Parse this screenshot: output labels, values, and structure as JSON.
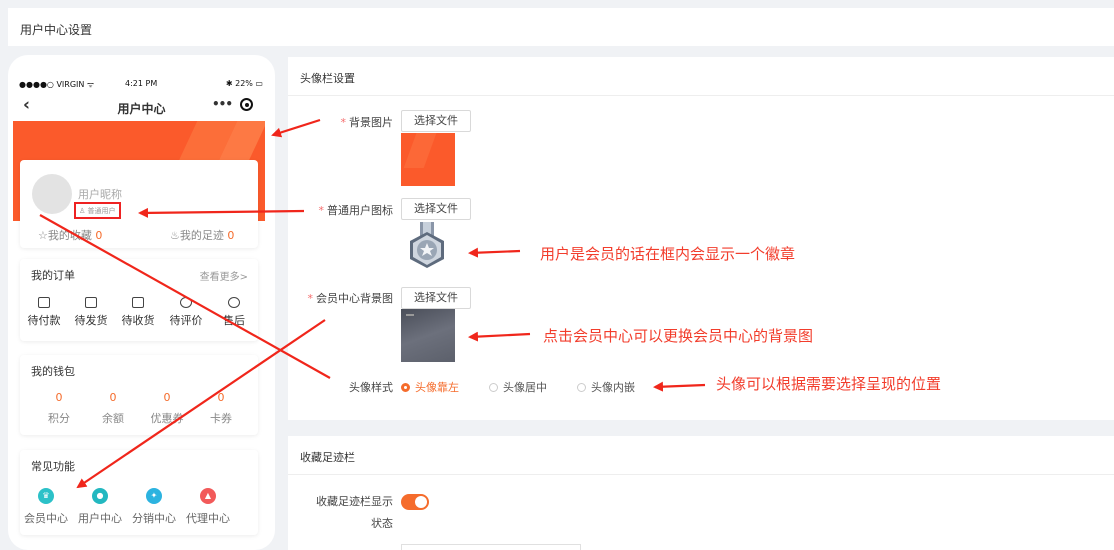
{
  "page": {
    "title": "用户中心设置"
  },
  "phone": {
    "status_left": "●●●●○ VIRGIN ᯤ",
    "status_time": "4:21 PM",
    "status_right": "✱ 22% ▭",
    "nav_back": "‹",
    "nav_title": "用户中心",
    "nav_more": "•••",
    "user_nickname": "用户昵称",
    "user_badge": "普通用户",
    "favorites_label": "我的收藏",
    "favorites_count": "0",
    "footprint_label": "我的足迹",
    "footprint_count": "0",
    "orders_title": "我的订单",
    "orders_more": "查看更多>",
    "orders": [
      "待付款",
      "待发货",
      "待收货",
      "待评价",
      "售后"
    ],
    "wallet_title": "我的钱包",
    "wallet": [
      {
        "value": "0",
        "label": "积分"
      },
      {
        "value": "0",
        "label": "余额"
      },
      {
        "value": "0",
        "label": "优惠券"
      },
      {
        "value": "0",
        "label": "卡券"
      }
    ],
    "functions_title": "常见功能",
    "functions": [
      {
        "label": "会员中心",
        "color": "#2cc1c8",
        "icon": "crown-icon"
      },
      {
        "label": "用户中心",
        "color": "#23b8c0",
        "icon": "user-icon"
      },
      {
        "label": "分销中心",
        "color": "#2cb3e0",
        "icon": "share-icon"
      },
      {
        "label": "代理中心",
        "color": "#f25a5a",
        "icon": "agent-icon"
      }
    ]
  },
  "avatar_panel": {
    "title": "头像栏设置",
    "bg_image_label": "背景图片",
    "user_icon_label": "普通用户图标",
    "vip_bg_label": "会员中心背景图",
    "choose_file": "选择文件",
    "avatar_style_label": "头像样式",
    "avatar_style_options": [
      "头像靠左",
      "头像居中",
      "头像内嵌"
    ],
    "avatar_style_selected": 0
  },
  "collect_panel": {
    "title": "收藏足迹栏",
    "display_label_1": "收藏足迹栏显示",
    "display_label_2": "状态",
    "display_on": true
  },
  "annotations": {
    "badge_note": "用户是会员的话在框内会显示一个徽章",
    "vip_bg_note": "点击会员中心可以更换会员中心的背景图",
    "avatar_note": "头像可以根据需要选择呈现的位置"
  },
  "colors": {
    "accent": "#f56c2c",
    "annotation": "#f23d2c",
    "banner": "#fb5a2b"
  }
}
